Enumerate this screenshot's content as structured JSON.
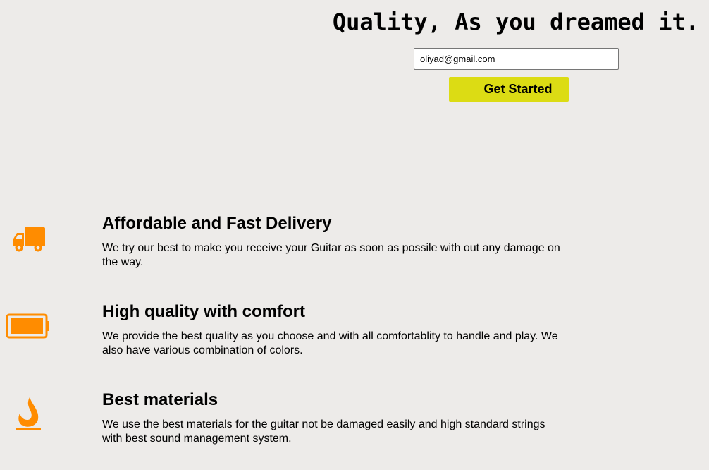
{
  "hero": {
    "title": "Quality, As you dreamed it.",
    "email_value": "oliyad@gmail.com",
    "button_label": "Get Started"
  },
  "features": [
    {
      "icon": "truck-icon",
      "title": "Affordable and Fast Delivery",
      "description": "We try our best to make you receive your Guitar as soon as possile with out any damage on the way."
    },
    {
      "icon": "battery-full-icon",
      "title": "High quality with comfort",
      "description": "We provide the best quality as you choose and with all comfortablity to handle and play. We also have various combination of colors."
    },
    {
      "icon": "fire-icon",
      "title": "Best materials",
      "description": "We use the best materials for the guitar not be damaged easily and high standard strings with best sound management system."
    }
  ],
  "colors": {
    "background": "#edebe9",
    "icon": "#ff8c00",
    "button": "#dcdc14"
  }
}
